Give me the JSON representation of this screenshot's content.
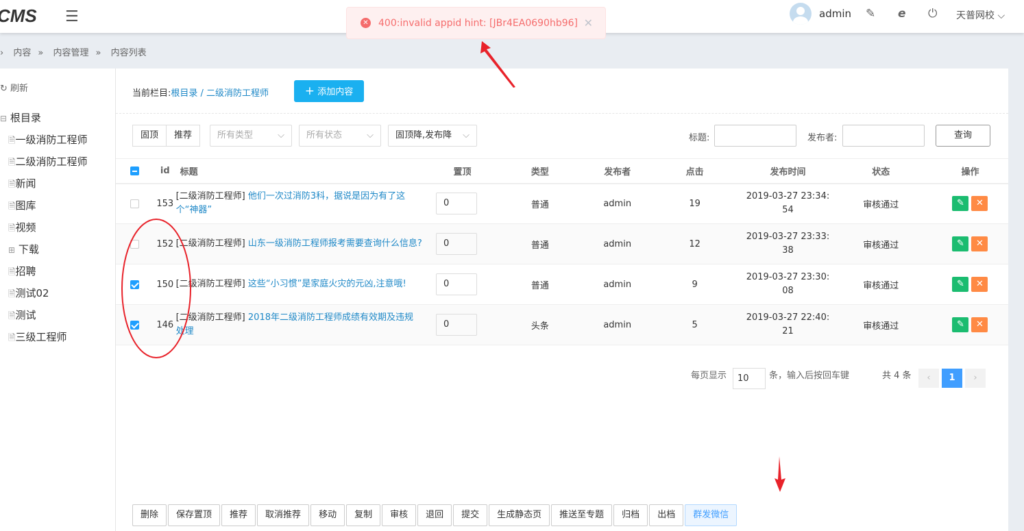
{
  "header": {
    "logo": "CMS",
    "user": "admin",
    "school": "天普网校"
  },
  "toast": {
    "message": "400:invalid appid hint: [JBr4EA0690hb96]"
  },
  "breadcrumb": [
    "内容",
    "内容管理",
    "内容列表"
  ],
  "sidebar": {
    "refresh": "刷新",
    "tree": [
      {
        "label": "根目录",
        "icon": "minus-box"
      },
      {
        "label": "一级消防工程师",
        "icon": "doc"
      },
      {
        "label": "二级消防工程师",
        "icon": "doc"
      },
      {
        "label": "新闻",
        "icon": "doc"
      },
      {
        "label": "图库",
        "icon": "doc"
      },
      {
        "label": "视频",
        "icon": "doc"
      },
      {
        "label": "下载",
        "icon": "plus-box"
      },
      {
        "label": "招聘",
        "icon": "doc"
      },
      {
        "label": "测试02",
        "icon": "doc"
      },
      {
        "label": "测试",
        "icon": "doc"
      },
      {
        "label": "三级工程师",
        "icon": "doc"
      }
    ]
  },
  "main": {
    "current_label": "当前栏目:",
    "current_path": "根目录 / 二级消防工程师",
    "add_button": "添加内容",
    "filters": {
      "pin": "固顶",
      "recommend": "推荐",
      "type": "所有类型",
      "status": "所有状态",
      "sort": "固顶降,发布降",
      "title_label": "标题:",
      "publisher_label": "发布者:",
      "query": "查询"
    },
    "columns": [
      "id",
      "标题",
      "置顶",
      "类型",
      "发布者",
      "点击",
      "发布时间",
      "状态",
      "操作"
    ],
    "rows": [
      {
        "checked": false,
        "id": "153",
        "category": "[二级消防工程师]",
        "title": "他们一次过消防3科，据说是因为有了这个“神器”",
        "pin": "0",
        "type": "普通",
        "publisher": "admin",
        "clicks": "19",
        "time": "2019-03-27 23:34:54",
        "status": "审核通过"
      },
      {
        "checked": false,
        "id": "152",
        "category": "[二级消防工程师]",
        "title": "山东一级消防工程师报考需要查询什么信息?",
        "pin": "0",
        "type": "普通",
        "publisher": "admin",
        "clicks": "12",
        "time": "2019-03-27 23:33:38",
        "status": "审核通过"
      },
      {
        "checked": true,
        "id": "150",
        "category": "[二级消防工程师]",
        "title": "这些“小习惯”是家庭火灾的元凶,注意哦!",
        "pin": "0",
        "type": "普通",
        "publisher": "admin",
        "clicks": "9",
        "time": "2019-03-27 23:30:08",
        "status": "审核通过"
      },
      {
        "checked": true,
        "id": "146",
        "category": "[二级消防工程师]",
        "title": "2018年二级消防工程师成绩有效期及违规处理",
        "pin": "0",
        "type": "头条",
        "publisher": "admin",
        "clicks": "5",
        "time": "2019-03-27 22:40:21",
        "status": "审核通过"
      }
    ],
    "pagination": {
      "per_page_label": "每页显示",
      "per_page": "10",
      "per_page_hint": "条，输入后按回车键",
      "total": "共 4 条",
      "current": "1"
    },
    "actions": [
      "删除",
      "保存置顶",
      "推荐",
      "取消推荐",
      "移动",
      "复制",
      "审核",
      "退回",
      "提交",
      "生成静态页",
      "推送至专题",
      "归档",
      "出档",
      "群发微信"
    ]
  }
}
